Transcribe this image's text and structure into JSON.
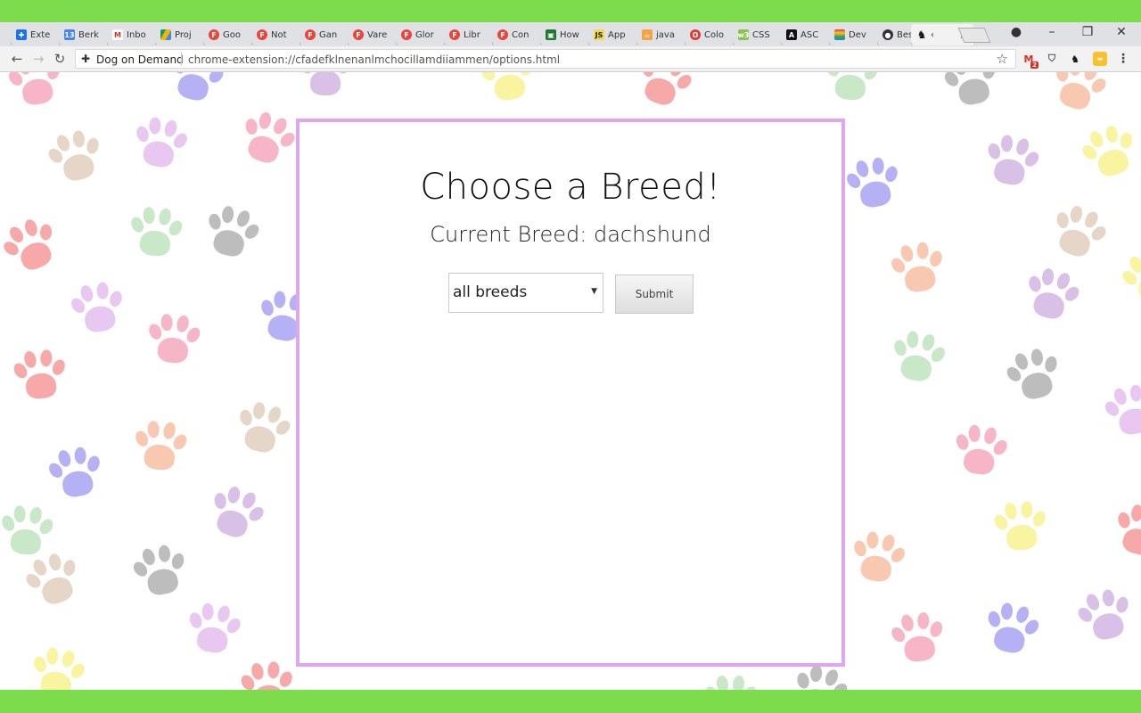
{
  "tabs": [
    {
      "label": "Exte",
      "favicon": "puzzle-icon"
    },
    {
      "label": "Berk",
      "favicon": "calendar-icon"
    },
    {
      "label": "Inbo",
      "favicon": "gmail-icon"
    },
    {
      "label": "Proj",
      "favicon": "drive-icon"
    },
    {
      "label": "Goo",
      "favicon": "f-icon"
    },
    {
      "label": "Not",
      "favicon": "f-icon"
    },
    {
      "label": "Gan",
      "favicon": "f-icon"
    },
    {
      "label": "Vare",
      "favicon": "f-icon"
    },
    {
      "label": "Glor",
      "favicon": "f-icon"
    },
    {
      "label": "Libr",
      "favicon": "f-icon"
    },
    {
      "label": "Con",
      "favicon": "f-icon"
    },
    {
      "label": "How",
      "favicon": "terminal-icon"
    },
    {
      "label": "App",
      "favicon": "js-icon"
    },
    {
      "label": "java",
      "favicon": "java-icon"
    },
    {
      "label": "Colo",
      "favicon": "opera-icon"
    },
    {
      "label": "CSS",
      "favicon": "w3-icon"
    },
    {
      "label": "ASC",
      "favicon": "a-icon"
    },
    {
      "label": "Dev",
      "favicon": "rainbow-icon"
    },
    {
      "label": "Best",
      "favicon": "circle-icon"
    },
    {
      "label": "‹",
      "favicon": "dog-icon",
      "active": true
    }
  ],
  "address_bar": {
    "site_name": "Dog on Demand",
    "url": "chrome-extension://cfadefklnenanlmchocillamdiiammen/options.html"
  },
  "toolbar_badges": {
    "gmail_count": "2"
  },
  "page": {
    "heading": "Choose a Breed!",
    "current_breed_label": "Current Breed: dachshund",
    "breed_select_value": "all breeds",
    "submit_label": "Submit"
  },
  "colors": {
    "accent_border": "#dfa6ef",
    "frame_green": "#7cdc4c"
  }
}
